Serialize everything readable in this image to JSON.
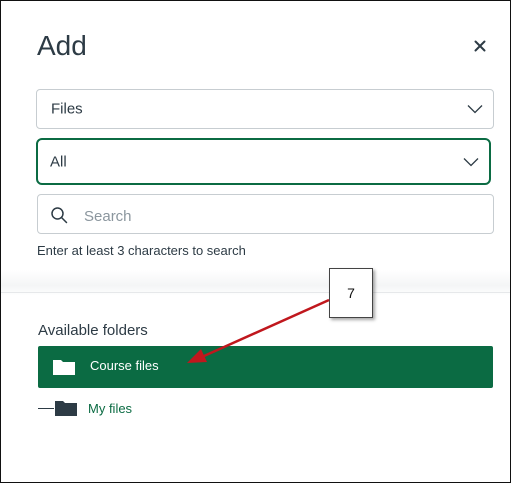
{
  "dialog": {
    "title": "Add",
    "close_label": "×"
  },
  "type_select": {
    "value": "Files"
  },
  "filter_select": {
    "value": "All"
  },
  "search": {
    "placeholder": "Search",
    "value": "",
    "hint": "Enter at least 3 characters to search"
  },
  "annotation": {
    "step": "7"
  },
  "folders": {
    "section_label": "Available folders",
    "items": [
      {
        "label": "Course files",
        "selected": true
      },
      {
        "label": "My files",
        "selected": false
      }
    ]
  },
  "colors": {
    "accent": "#0b6b43",
    "text": "#2d3b45",
    "arrow": "#c0171d"
  },
  "icons": {
    "close": "close-icon",
    "chevron": "chevron-down-icon",
    "search": "search-icon",
    "folder": "folder-icon"
  }
}
